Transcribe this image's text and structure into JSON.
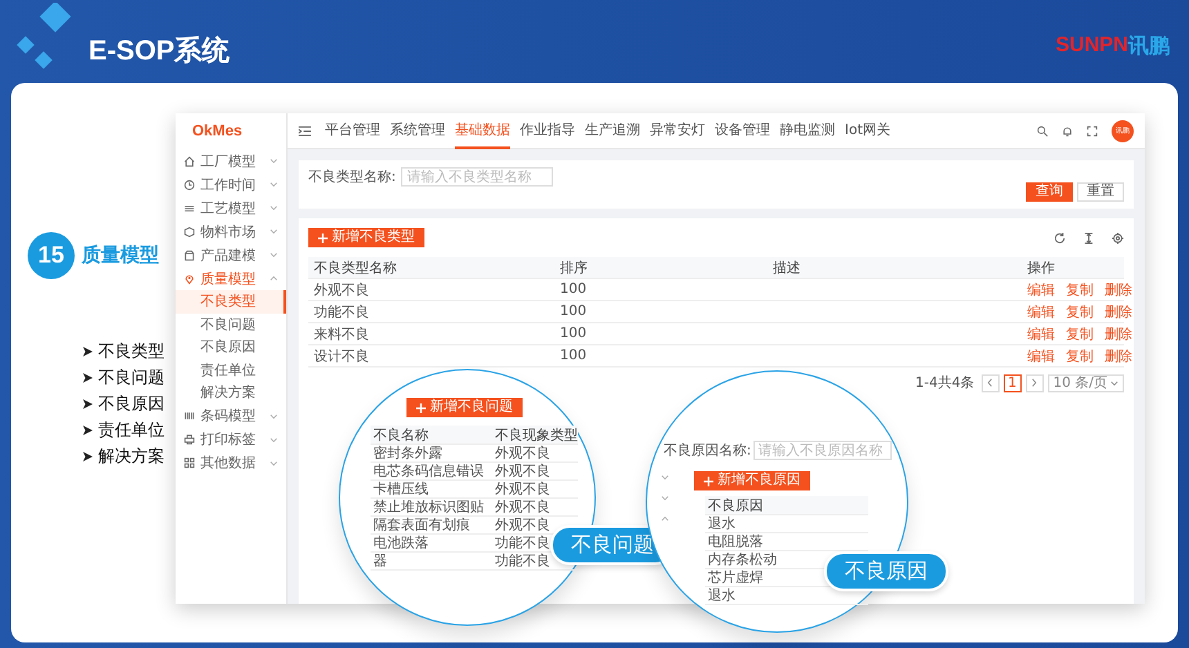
{
  "header": {
    "title": "E-SOP系统",
    "logo": {
      "latin": "SUNPN",
      "cjk": "讯鹏"
    }
  },
  "section": {
    "number": "15",
    "title": "质量模型",
    "bullets": [
      "不良类型",
      "不良问题",
      "不良原因",
      "责任单位",
      "解决方案"
    ]
  },
  "app": {
    "brand": "OkMes",
    "sidebar": [
      {
        "label": "工厂模型",
        "expanded": false
      },
      {
        "label": "工作时间",
        "expanded": false
      },
      {
        "label": "工艺模型",
        "expanded": false
      },
      {
        "label": "物料市场",
        "expanded": false
      },
      {
        "label": "产品建模",
        "expanded": false
      },
      {
        "label": "质量模型",
        "expanded": true,
        "children": [
          {
            "label": "不良类型",
            "selected": true
          },
          {
            "label": "不良问题",
            "selected": false
          },
          {
            "label": "不良原因",
            "selected": false
          },
          {
            "label": "责任单位",
            "selected": false
          },
          {
            "label": "解决方案",
            "selected": false
          }
        ]
      },
      {
        "label": "条码模型",
        "expanded": false
      },
      {
        "label": "打印标签",
        "expanded": false
      },
      {
        "label": "其他数据",
        "expanded": false
      }
    ],
    "nav": [
      {
        "label": "平台管理",
        "selected": false
      },
      {
        "label": "系统管理",
        "selected": false
      },
      {
        "label": "基础数据",
        "selected": true
      },
      {
        "label": "作业指导",
        "selected": false
      },
      {
        "label": "生产追溯",
        "selected": false
      },
      {
        "label": "异常安灯",
        "selected": false
      },
      {
        "label": "设备管理",
        "selected": false
      },
      {
        "label": "静电监测",
        "selected": false
      },
      {
        "label": "Iot网关",
        "selected": false
      }
    ],
    "avatar": "讯鹏",
    "filter": {
      "label": "不良类型名称:",
      "placeholder": "请输入不良类型名称",
      "buttons": [
        {
          "label": "查询",
          "kind": "primary"
        },
        {
          "label": "重置",
          "kind": "default"
        }
      ]
    },
    "table": {
      "add_button": "新增不良类型",
      "columns": [
        "不良类型名称",
        "排序",
        "描述",
        "操作"
      ],
      "rows": [
        {
          "name": "外观不良",
          "order": "100",
          "actions": [
            "编辑",
            "复制",
            "删除"
          ]
        },
        {
          "name": "功能不良",
          "order": "100",
          "actions": [
            "编辑",
            "复制",
            "删除"
          ]
        },
        {
          "name": "来料不良",
          "order": "100",
          "actions": [
            "编辑",
            "复制",
            "删除"
          ]
        },
        {
          "name": "设计不良",
          "order": "100",
          "actions": [
            "编辑",
            "复制",
            "删除"
          ]
        }
      ]
    },
    "pagination": {
      "summary": "1-4共4条",
      "pages": [
        {
          "label": "1",
          "selected": true
        }
      ],
      "page_size": "10 条/页"
    }
  },
  "zoom_problems": {
    "callout": "不良问题",
    "add_button": "新增不良问题",
    "columns": [
      "不良名称",
      "不良现象类型"
    ],
    "rows": [
      {
        "name": "密封条外露",
        "type": "外观不良"
      },
      {
        "name": "电芯条码信息错误",
        "type": "外观不良"
      },
      {
        "name": "卡槽压线",
        "type": "外观不良"
      },
      {
        "name": "禁止堆放标识图贴",
        "type": "外观不良"
      },
      {
        "name": "隔套表面有划痕",
        "type": "外观不良"
      },
      {
        "name": "电池跌落",
        "type": "功能不良"
      },
      {
        "name": "器",
        "type": "功能不良"
      }
    ]
  },
  "zoom_causes": {
    "callout": "不良原因",
    "filter_label": "不良原因名称:",
    "placeholder": "请输入不良原因名称",
    "add_button": "新增不良原因",
    "columns": [
      "不良原因"
    ],
    "sidebar_carets": [
      {
        "expanded": false
      },
      {
        "expanded": false
      },
      {
        "expanded": true
      }
    ],
    "rows": [
      "退水",
      "电阻脱落",
      "内存条松动",
      "芯片虚焊",
      "退水"
    ]
  }
}
